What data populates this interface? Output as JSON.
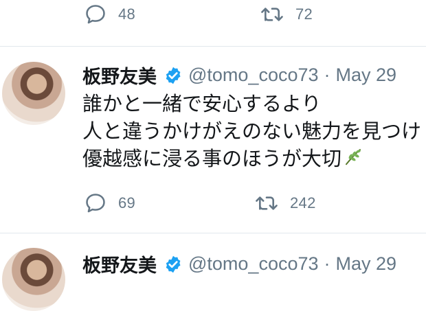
{
  "tweets": [
    {
      "reply_count": "48",
      "retweet_count": "72"
    },
    {
      "name": "板野友美",
      "handle": "@tomo_coco73",
      "separator": "·",
      "date": "May 29",
      "lines": [
        "誰かと一緒で安心するより",
        "人と違うかけがえのない魅力を見つけ",
        "優越感に浸る事のほうが大切"
      ],
      "emoji": "herb-icon",
      "reply_count": "69",
      "retweet_count": "242"
    },
    {
      "name": "板野友美",
      "handle": "@tomo_coco73",
      "separator": "·",
      "date": "May 29"
    }
  ],
  "colors": {
    "verified": "#1da1f2",
    "secondary_text": "#657786",
    "divider": "#e1e8ed"
  }
}
